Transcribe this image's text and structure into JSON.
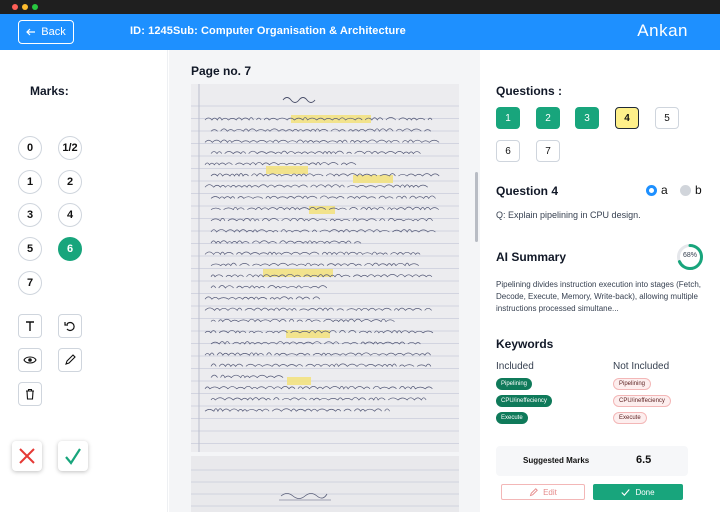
{
  "header": {
    "back_label": "Back",
    "title": "ID: 1245Sub: Computer Organisation & Architecture",
    "user": "Ankan",
    "bg_color": "#1e90ff"
  },
  "left": {
    "marks_title": "Marks:",
    "marks": [
      "0",
      "1/2",
      "1",
      "2",
      "3",
      "4",
      "5",
      "6",
      "7"
    ],
    "selected_mark": "6",
    "tools": [
      "text-icon",
      "undo-icon",
      "eye-icon",
      "pencil-icon",
      "trash-icon"
    ],
    "reject_icon": "cross-icon",
    "accept_icon": "check-icon"
  },
  "center": {
    "page_label": "Page no. 7",
    "page_image": "handwritten-answer-sheet"
  },
  "right": {
    "questions_title": "Questions :",
    "questions": [
      "1",
      "2",
      "3",
      "4",
      "5",
      "6",
      "7"
    ],
    "current_question": "4",
    "question_title": "Question 4",
    "options": [
      "a",
      "b"
    ],
    "selected_option": "a",
    "question_text": "Q: Explain pipelining in CPU design.",
    "ai_summary_title": "AI Summary",
    "ai_score": "68%",
    "ai_summary_text": "Pipelining divides instruction execution into stages (Fetch, Decode, Execute, Memory, Write-back), allowing multiple instructions processed simultane...",
    "keywords_title": "Keywords",
    "included_label": "Included",
    "not_included_label": "Not Included",
    "included": [
      "Pipelining",
      "CPU/ineffeciency",
      "Execute"
    ],
    "not_included": [
      "Pipelining",
      "CPU/ineffeciency",
      "Execute"
    ],
    "suggested_label": "Suggested Marks",
    "suggested_value": "6.5",
    "edit_label": "Edit",
    "done_label": "Done",
    "accent_color": "#18a57c"
  }
}
